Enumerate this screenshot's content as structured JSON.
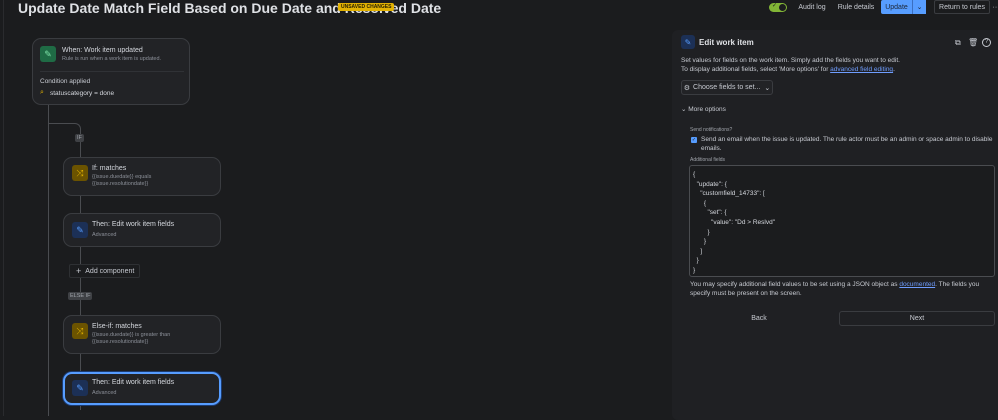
{
  "header": {
    "title": "Update Date Match Field Based on Due Date and Resolved Date",
    "badge": "UNSAVED CHANGES",
    "audit_log": "Audit log",
    "rule_details": "Rule details",
    "update": "Update",
    "return": "Return to rules",
    "more": "···",
    "toggle_on": true
  },
  "flow": {
    "trigger": {
      "title": "When: Work item updated",
      "subtitle": "Rule is run when a work item is updated.",
      "condition_label": "Condition applied",
      "condition": "statuscategory = done"
    },
    "if_tag": "IF",
    "else_if_tag": "ELSE IF",
    "if_card": {
      "title": "If: matches",
      "line1": "{{issue.duedate}} equals",
      "line2": "{{issue.resolutiondate}}"
    },
    "then1": {
      "title": "Then: Edit work item fields",
      "subtitle": "Advanced"
    },
    "add_component": "Add component",
    "elseif_card": {
      "title": "Else-if: matches",
      "line1": "{{issue.duedate}} is greater than",
      "line2": "{{issue.resolutiondate}}"
    },
    "then2": {
      "title": "Then: Edit work item fields",
      "subtitle": "Advanced"
    }
  },
  "panel": {
    "title": "Edit work item",
    "desc1": "Set values for fields on the work item. Simply add the fields you want to edit.",
    "desc2_pre": "To display additional fields, select 'More options' for ",
    "desc2_link": "advanced field editing",
    "desc2_post": ".",
    "choose_fields": "Choose fields to set...",
    "more_options": "More options",
    "send_notifications_label": "Send notifications?",
    "send_email": "Send an email when the issue is updated. The rule actor must be an admin or space admin to disable emails.",
    "send_email_checked": true,
    "additional_fields_label": "Additional fields",
    "additional_fields_value": "{\n  \"update\": {\n    \"customfield_14733\": [\n      {\n        \"set\": {\n          \"value\": \"Dd > Reslvd\"\n        }\n      }\n    ]\n  }\n}",
    "help_pre": "You may specify additional field values to be set using a JSON object as ",
    "help_link": "documented",
    "help_post": ". The fields you specify must be present on the screen.",
    "back": "Back",
    "next": "Next"
  }
}
